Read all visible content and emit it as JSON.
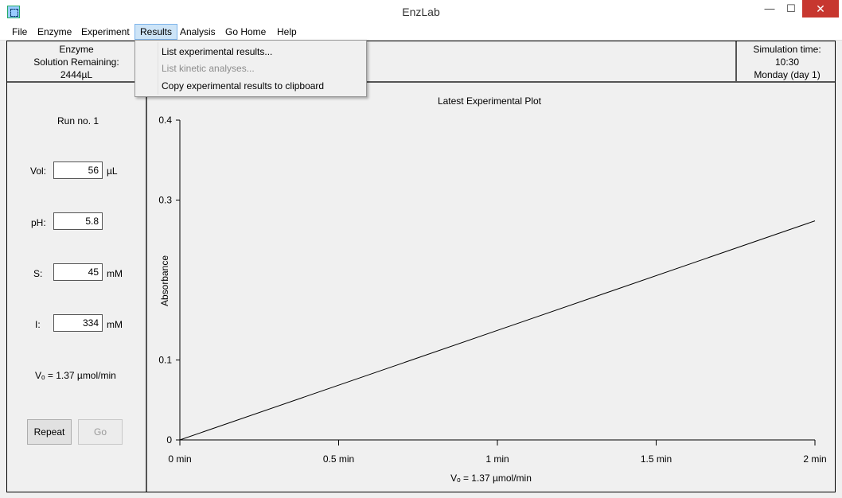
{
  "window": {
    "title": "EnzLab",
    "minimize": "—",
    "maximize": "☐",
    "close": "✕"
  },
  "menu": [
    {
      "label": "File"
    },
    {
      "label": "Enzyme"
    },
    {
      "label": "Experiment"
    },
    {
      "label": "Results"
    },
    {
      "label": "Analysis"
    },
    {
      "label": "Go Home"
    },
    {
      "label": "Help"
    }
  ],
  "results_menu": [
    {
      "label": "List experimental results...",
      "enabled": true
    },
    {
      "label": "List kinetic analyses...",
      "enabled": false
    },
    {
      "label": "Copy experimental results to clipboard",
      "enabled": true
    }
  ],
  "enzyme": {
    "line1": "Enzyme",
    "line2": "Solution Remaining:",
    "amount": "2444µL"
  },
  "simulation": {
    "label": "Simulation time:",
    "time": "10:30",
    "day": "Monday (day 1)"
  },
  "run": {
    "label": "Run no. 1"
  },
  "params": {
    "vol": {
      "label": "Vol:",
      "value": "56",
      "unit": "µL"
    },
    "ph": {
      "label": "pH:",
      "value": "5.8",
      "unit": ""
    },
    "s": {
      "label": "S:",
      "value": "45",
      "unit": "mM"
    },
    "i": {
      "label": "I:",
      "value": "334",
      "unit": "mM"
    }
  },
  "vo_readout": "Vₒ = 1.37 µmol/min",
  "buttons": {
    "repeat": "Repeat",
    "go": "Go"
  },
  "chart_data": {
    "type": "line",
    "title": "Latest Experimental Plot",
    "xlabel": "Vₒ = 1.37 µmol/min",
    "ylabel": "Absorbance",
    "x_ticks": [
      {
        "value": 0,
        "label": "0 min"
      },
      {
        "value": 0.5,
        "label": "0.5 min"
      },
      {
        "value": 1,
        "label": "1 min"
      },
      {
        "value": 1.5,
        "label": "1.5 min"
      },
      {
        "value": 2,
        "label": "2 min"
      }
    ],
    "y_ticks": [
      {
        "value": 0,
        "label": "0"
      },
      {
        "value": 0.1,
        "label": "0.1"
      },
      {
        "value": 0.3,
        "label": "0.3"
      },
      {
        "value": 0.4,
        "label": "0.4"
      }
    ],
    "xlim": [
      0,
      2
    ],
    "ylim": [
      0,
      0.4
    ],
    "grid": false,
    "series": [
      {
        "x": [
          0,
          2
        ],
        "y": [
          0,
          0.274
        ]
      }
    ]
  }
}
